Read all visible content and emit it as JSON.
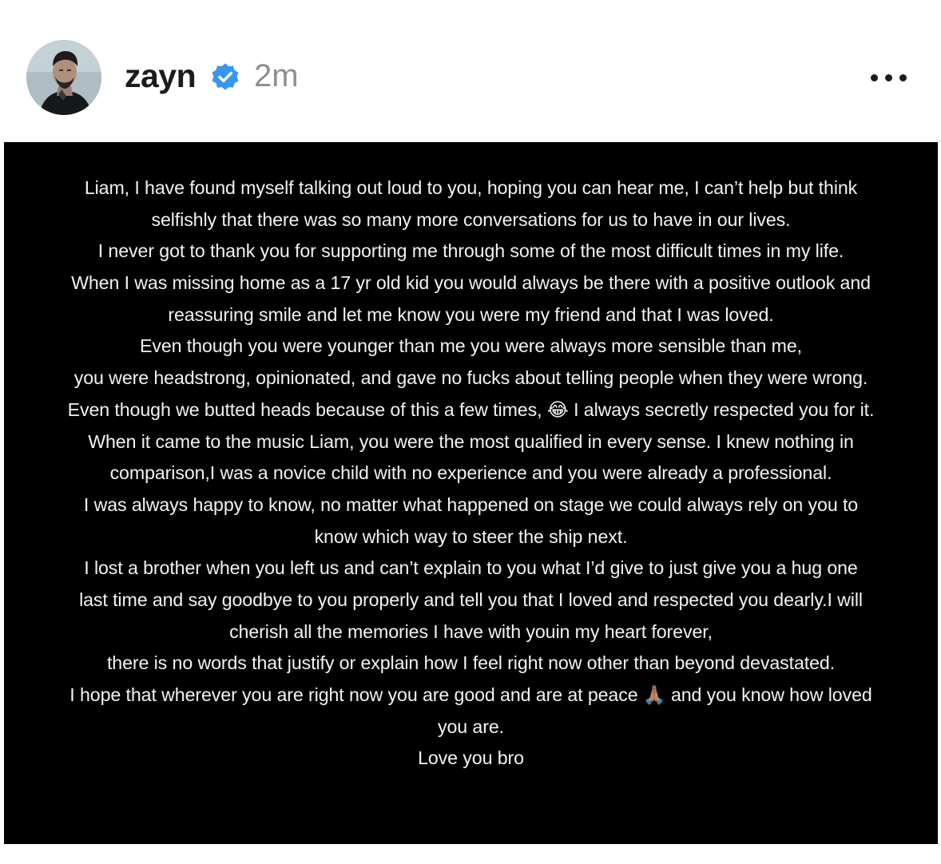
{
  "post": {
    "username": "zayn",
    "timestamp": "2m",
    "message_lines": [
      "Liam, I have found myself talking out loud to you, hoping you can hear me, I can’t help but think",
      "selfishly that there was so many more conversations for us to have in our lives.",
      "I never got to thank you for supporting me through some of the most difficult times in my life.",
      "When I was missing home as a 17 yr old kid you would always be there with a positive outlook and",
      "reassuring smile and let me know you were my friend and that I was loved.",
      "Even though you were younger than me you were always more sensible than me,",
      "you were headstrong, opinionated, and gave no fucks about telling people when they were wrong.",
      "Even though we butted heads because of this a few times, 😂 I always secretly respected you for it.",
      "When it came to the music Liam, you were the most qualified in every sense. I knew nothing in",
      "comparison,I was a novice child with no experience and you were already a professional.",
      "I was always happy to know, no matter what happened on stage we could always rely on you to",
      "know which way to steer the ship next.",
      "I lost a brother when you left us and can’t explain to you what I’d give to just give you a hug one",
      "last time and say goodbye to you properly and tell you that I loved and respected you  dearly.I will",
      "cherish all the memories I have with youin my heart forever,",
      "there is no words that justify or explain how I feel right now other than beyond devastated.",
      "I hope that wherever you are right now you are good and are at peace 🙏🏽 and you know how loved",
      "you are.",
      "Love you bro"
    ]
  },
  "icons": {
    "avatar": "profile-photo",
    "verified": "verified-badge-icon",
    "more": "more-options-icon"
  },
  "colors": {
    "verified_blue": "#3797f0",
    "text_dark": "#1c1c1e",
    "timestamp_gray": "#8e8e93",
    "image_background": "#000000",
    "image_text": "#f2f2f2"
  }
}
